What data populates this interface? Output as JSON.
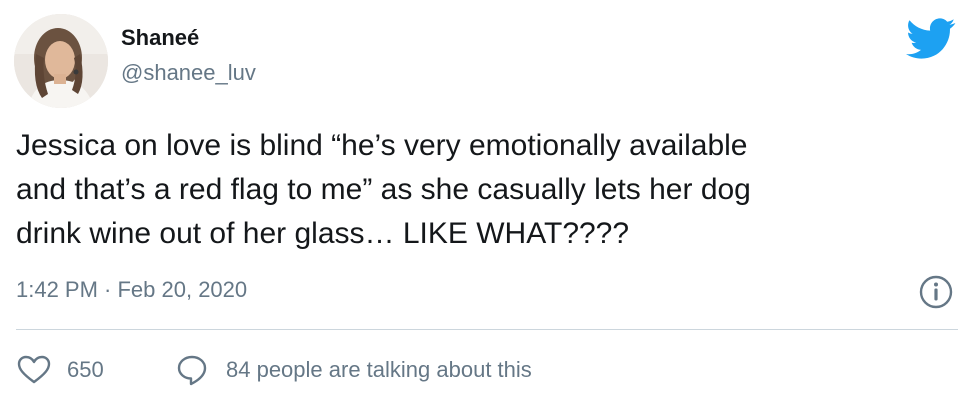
{
  "author": {
    "display_name": "Shaneé",
    "handle": "@shanee_luv",
    "avatar_icon": "profile-photo"
  },
  "brand": {
    "icon": "twitter-bird-icon",
    "color": "#1da1f2"
  },
  "tweet": {
    "lines": [
      "Jessica on love is blind “he’s very emotionally available",
      "and that’s a red flag to me” as she casually lets her dog",
      "drink wine out of her glass… LIKE WHAT????"
    ],
    "timestamp": "1:42 PM · Feb 20, 2020"
  },
  "actions": {
    "like_count": "650",
    "talking_label": "84 people are talking about this"
  },
  "colors": {
    "text": "#14171a",
    "secondary": "#657786",
    "divider": "#ccd6dd"
  }
}
